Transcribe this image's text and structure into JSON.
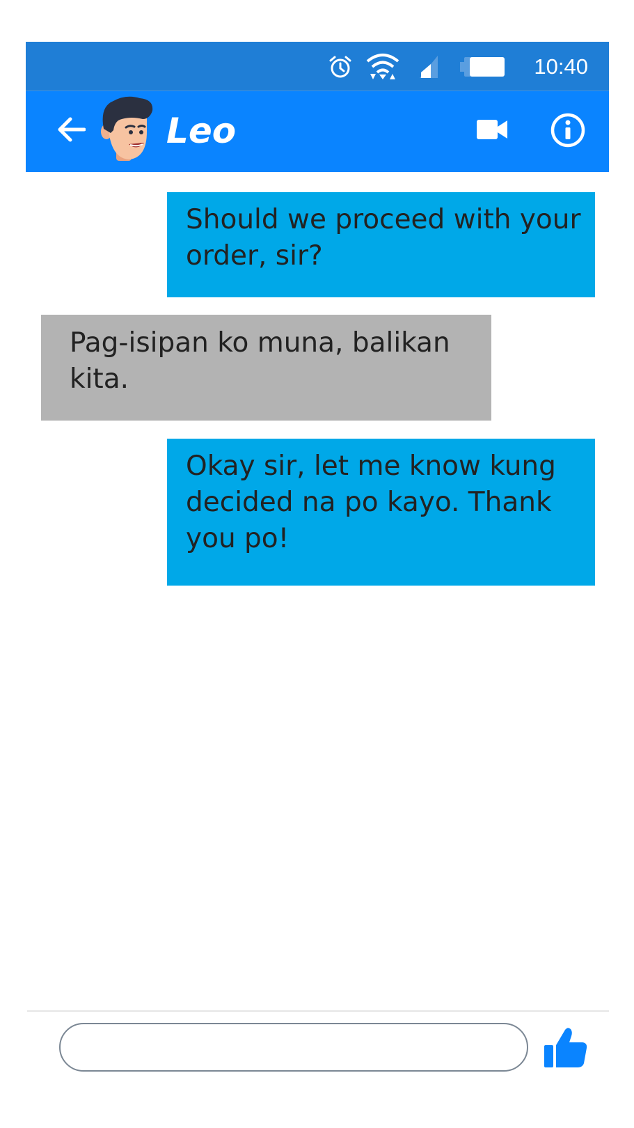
{
  "status_bar": {
    "time": "10:40",
    "icons": [
      "alarm-icon",
      "wifi-icon",
      "signal-icon",
      "battery-icon"
    ]
  },
  "header": {
    "contact_name": "Leo",
    "icons": [
      "back-arrow-icon",
      "avatar",
      "video-camera-icon",
      "info-icon"
    ]
  },
  "messages": [
    {
      "direction": "outgoing",
      "text": "Should we proceed with your order, sir?"
    },
    {
      "direction": "incoming",
      "text": "Pag-isipan ko muna, balikan kita."
    },
    {
      "direction": "outgoing",
      "text": "Okay sir, let me know kung decided na po kayo. Thank you po!"
    }
  ],
  "composer": {
    "input_value": "",
    "placeholder": "",
    "send_icon": "thumbs-up-icon"
  },
  "colors": {
    "status_bar": "#1f7ed6",
    "header": "#0a84ff",
    "outgoing_bubble": "#00a8e8",
    "incoming_bubble": "#b3b3b3",
    "like_icon": "#0a84ff"
  }
}
